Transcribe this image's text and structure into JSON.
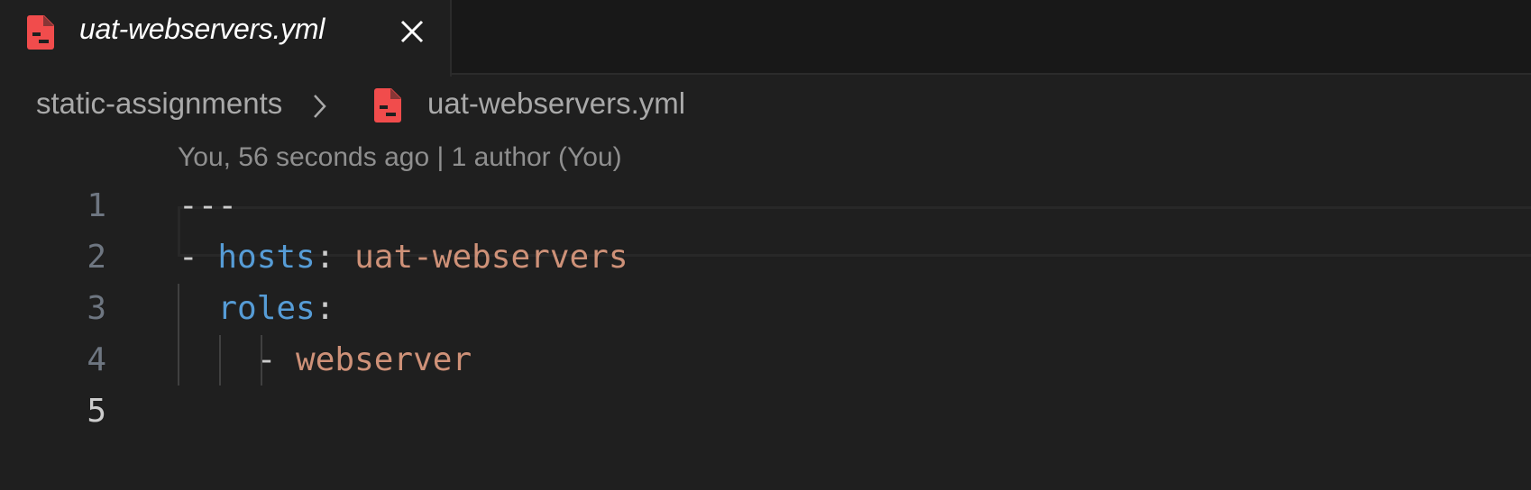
{
  "tab": {
    "label": "uat-webservers.yml",
    "icon": "yaml-file-icon",
    "close": "close-icon"
  },
  "breadcrumb": {
    "folder": "static-assignments",
    "separator": "›",
    "file": "uat-webservers.yml"
  },
  "blame": "You, 56 seconds ago | 1 author (You)",
  "lines": [
    {
      "n": "1",
      "parts": [
        {
          "t": "---",
          "c": "plain"
        }
      ]
    },
    {
      "n": "2",
      "parts": [
        {
          "t": "- ",
          "c": "plain"
        },
        {
          "t": "hosts",
          "c": "key"
        },
        {
          "t": ": ",
          "c": "plain"
        },
        {
          "t": "uat-webservers",
          "c": "str"
        }
      ]
    },
    {
      "n": "3",
      "parts": [
        {
          "t": "  ",
          "c": "plain"
        },
        {
          "t": "roles",
          "c": "key"
        },
        {
          "t": ":",
          "c": "plain"
        }
      ]
    },
    {
      "n": "4",
      "parts": [
        {
          "t": "    - ",
          "c": "plain"
        },
        {
          "t": "webserver",
          "c": "str"
        }
      ]
    },
    {
      "n": "5",
      "parts": []
    }
  ],
  "active_line": "5",
  "colors": {
    "accent_icon": "#f14c4c",
    "key": "#569cd6",
    "string": "#ce9178"
  }
}
